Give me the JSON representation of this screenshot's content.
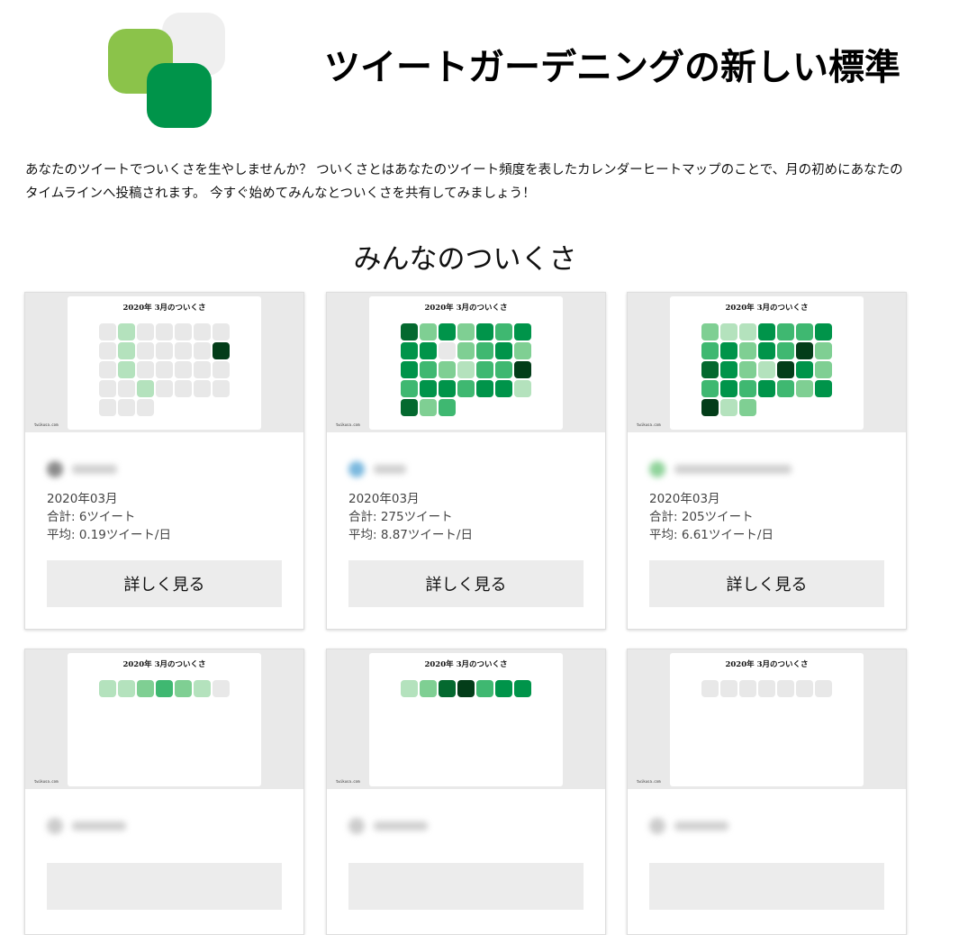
{
  "header": {
    "title": "ツイートガーデニングの新しい標準"
  },
  "intro": {
    "text": "あなたのツイートでついくさを生やしませんか？ ついくさとはあなたのツイート頻度を表したカレンダーヒートマップのことで、月の初めにあなたのタイムラインへ投稿されます。 今すぐ始めてみんなとついくさを共有してみましょう！"
  },
  "section": {
    "title": "みんなのついくさ"
  },
  "palette": {
    "0": "#e8e8e8",
    "1": "#b4e2bd",
    "2": "#7fcf93",
    "3": "#3fb871",
    "4": "#00944a",
    "5": "#04692f",
    "6": "#033d19",
    "brand_light_green": "#8bc34a",
    "brand_dark_green": "#00944a"
  },
  "cards": [
    {
      "thumb_title": "2020年 3月のついくさ",
      "thumb_footer": "twikusa.com",
      "avatar_color": "#8a8a8a",
      "name_width": 50,
      "month": "2020年03月",
      "total": "合計: 6ツイート",
      "average": "平均: 0.19ツイート/日",
      "button": "詳しく見る",
      "levels": [
        0,
        1,
        0,
        0,
        0,
        0,
        0,
        0,
        1,
        0,
        0,
        0,
        0,
        6,
        0,
        1,
        0,
        0,
        0,
        0,
        0,
        0,
        0,
        1,
        0,
        0,
        0,
        0,
        0,
        0,
        0
      ]
    },
    {
      "thumb_title": "2020年 3月のついくさ",
      "thumb_footer": "twikusa.com",
      "avatar_color": "#7ab8de",
      "name_width": 36,
      "month": "2020年03月",
      "total": "合計: 275ツイート",
      "average": "平均: 8.87ツイート/日",
      "button": "詳しく見る",
      "levels": [
        5,
        2,
        4,
        2,
        4,
        3,
        4,
        4,
        4,
        0,
        2,
        3,
        4,
        2,
        4,
        3,
        2,
        1,
        3,
        3,
        6,
        3,
        4,
        4,
        3,
        4,
        4,
        1,
        5,
        2,
        3
      ]
    },
    {
      "thumb_title": "2020年 3月のついくさ",
      "thumb_footer": "twikusa.com",
      "avatar_color": "#8fd39a",
      "name_width": 130,
      "month": "2020年03月",
      "total": "合計: 205ツイート",
      "average": "平均: 6.61ツイート/日",
      "button": "詳しく見る",
      "levels": [
        2,
        1,
        1,
        4,
        3,
        3,
        4,
        3,
        4,
        2,
        4,
        3,
        6,
        2,
        5,
        4,
        2,
        1,
        6,
        4,
        2,
        3,
        4,
        3,
        4,
        3,
        2,
        4,
        6,
        1,
        2
      ]
    },
    {
      "thumb_title": "2020年 3月のついくさ",
      "thumb_footer": "twikusa.com",
      "avatar_color": "#cccccc",
      "name_width": 60,
      "month": "",
      "total": "",
      "average": "",
      "button": "",
      "levels": [
        1,
        1,
        2,
        3,
        2,
        1,
        0
      ]
    },
    {
      "thumb_title": "2020年 3月のついくさ",
      "thumb_footer": "twikusa.com",
      "avatar_color": "#cccccc",
      "name_width": 60,
      "month": "",
      "total": "",
      "average": "",
      "button": "",
      "levels": [
        1,
        2,
        5,
        6,
        3,
        4,
        4
      ]
    },
    {
      "thumb_title": "2020年 3月のついくさ",
      "thumb_footer": "twikusa.com",
      "avatar_color": "#cccccc",
      "name_width": 60,
      "month": "",
      "total": "",
      "average": "",
      "button": "",
      "levels": [
        0,
        0,
        0,
        0,
        0,
        0,
        0
      ]
    }
  ]
}
